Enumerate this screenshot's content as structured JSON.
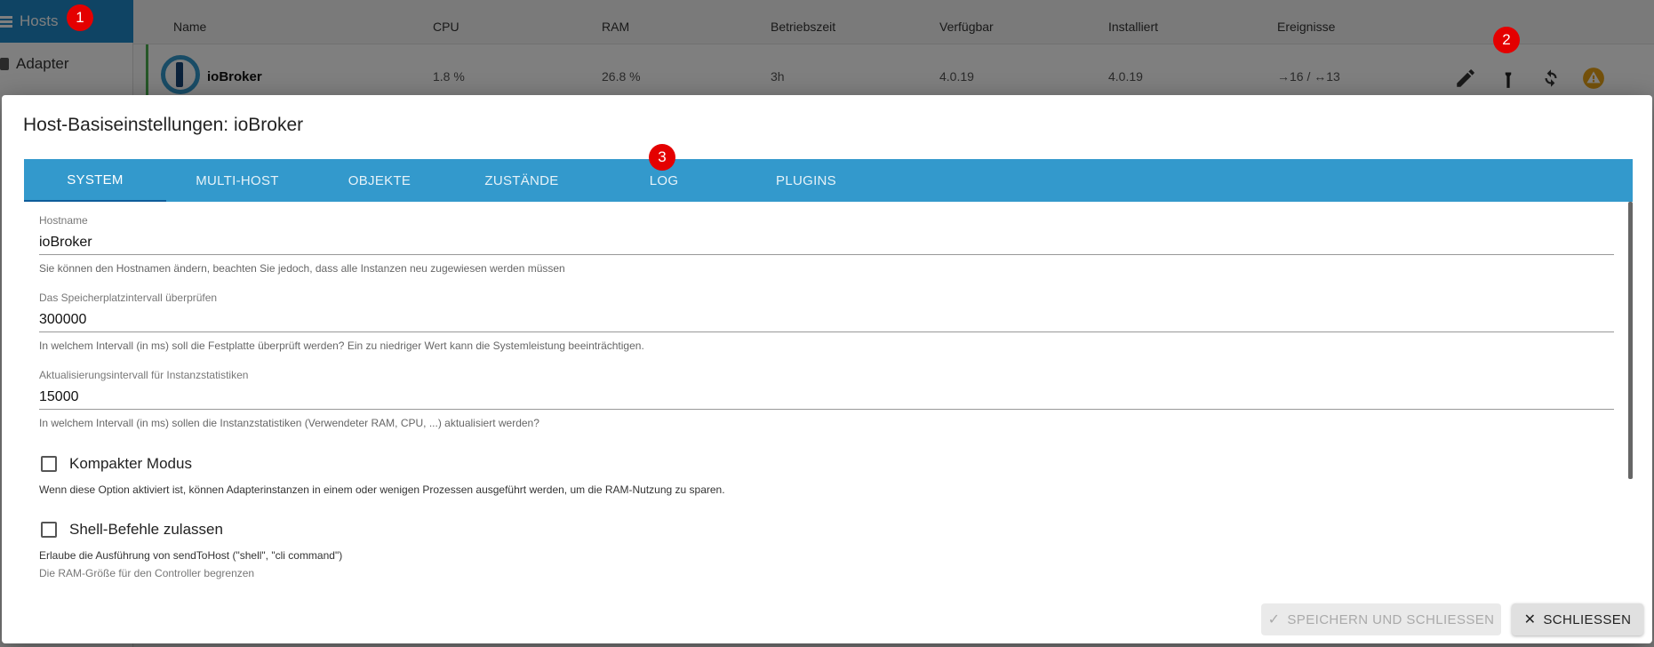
{
  "sidebar": {
    "items": [
      {
        "label": "Hosts"
      },
      {
        "label": "Adapter"
      }
    ]
  },
  "hosts_table": {
    "columns": [
      "Name",
      "CPU",
      "RAM",
      "Betriebszeit",
      "Verfügbar",
      "Installiert",
      "Ereignisse"
    ],
    "row": {
      "name": "ioBroker",
      "cpu": "1.8 %",
      "ram": "26.8 %",
      "uptime": "3h",
      "available": "4.0.19",
      "installed": "4.0.19",
      "events": "→16 / ↔13"
    }
  },
  "badges": [
    "1",
    "2",
    "3"
  ],
  "dialog": {
    "title": "Host-Basiseinstellungen: ioBroker",
    "tabs": [
      "SYSTEM",
      "MULTI-HOST",
      "OBJEKTE",
      "ZUSTÄNDE",
      "LOG",
      "PLUGINS"
    ],
    "fields": [
      {
        "label": "Hostname",
        "value": "ioBroker",
        "help": "Sie können den Hostnamen ändern, beachten Sie jedoch, dass alle Instanzen neu zugewiesen werden müssen"
      },
      {
        "label": "Das Speicherplatzintervall überprüfen",
        "value": "300000",
        "help": "In welchem Intervall (in ms) soll die Festplatte überprüft werden? Ein zu niedriger Wert kann die Systemleistung beeinträchtigen."
      },
      {
        "label": "Aktualisierungsintervall für Instanzstatistiken",
        "value": "15000",
        "help": "In welchem Intervall (in ms) sollen die Instanzstatistiken (Verwendeter RAM, CPU, ...) aktualisiert werden?"
      }
    ],
    "checkboxes": [
      {
        "label": "Kompakter Modus",
        "help": "Wenn diese Option aktiviert ist, können Adapterinstanzen in einem oder wenigen Prozessen ausgeführt werden, um die RAM-Nutzung zu sparen."
      },
      {
        "label": "Shell-Befehle zulassen",
        "help": "Erlaube die Ausführung von sendToHost (\"shell\", \"cli command\")"
      }
    ],
    "partial_label": "Die RAM-Größe für den Controller begrenzen",
    "save_label": "SPEICHERN UND SCHLIESSEN",
    "close_label": "SCHLIESSEN"
  },
  "colors": {
    "accent": "#3399cc",
    "sidebar_active": "#1e88c9",
    "badge": "#e40000"
  }
}
